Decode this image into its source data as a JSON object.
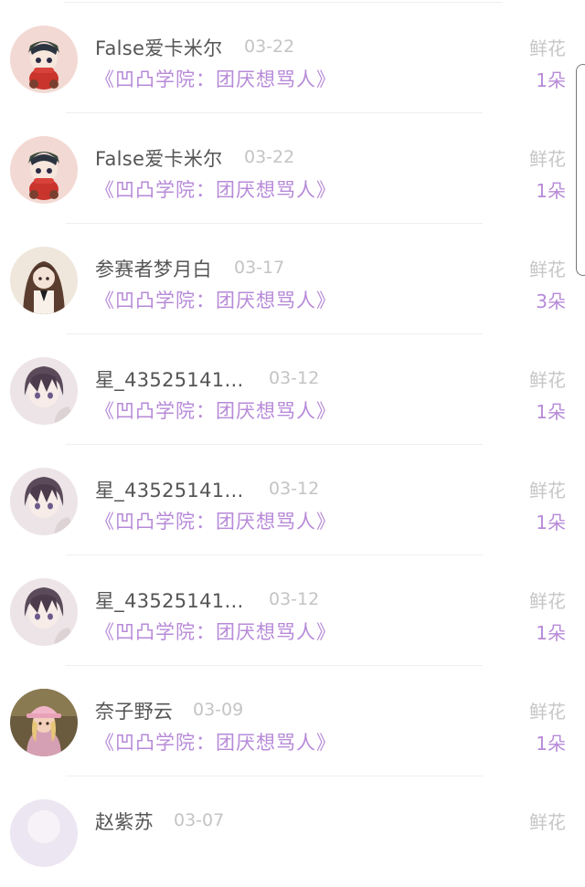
{
  "rows": [
    {
      "name": "False爱卡米尔",
      "date": "03-22",
      "title": "《凹凸学院：团厌想骂人》",
      "gift": "鲜花",
      "count": "1朵",
      "avatar": "chibi-red-scarf-avatar"
    },
    {
      "name": "False爱卡米尔",
      "date": "03-22",
      "title": "《凹凸学院：团厌想骂人》",
      "gift": "鲜花",
      "count": "1朵",
      "avatar": "chibi-red-scarf-avatar"
    },
    {
      "name": "参赛者梦月白",
      "date": "03-17",
      "title": "《凹凸学院：团厌想骂人》",
      "gift": "鲜花",
      "count": "3朵",
      "avatar": "long-hair-girl-avatar"
    },
    {
      "name": "星_43525141…",
      "date": "03-12",
      "title": "《凹凸学院：团厌想骂人》",
      "gift": "鲜花",
      "count": "1朵",
      "avatar": "dark-hair-boy-avatar"
    },
    {
      "name": "星_43525141…",
      "date": "03-12",
      "title": "《凹凸学院：团厌想骂人》",
      "gift": "鲜花",
      "count": "1朵",
      "avatar": "dark-hair-boy-avatar"
    },
    {
      "name": "星_43525141…",
      "date": "03-12",
      "title": "《凹凸学院：团厌想骂人》",
      "gift": "鲜花",
      "count": "1朵",
      "avatar": "dark-hair-boy-avatar"
    },
    {
      "name": "奈子野云",
      "date": "03-09",
      "title": "《凹凸学院：团厌想骂人》",
      "gift": "鲜花",
      "count": "1朵",
      "avatar": "pink-hat-girl-avatar"
    },
    {
      "name": "赵紫苏",
      "date": "03-07",
      "title": "",
      "gift": "鲜花",
      "count": "",
      "avatar": "light-avatar"
    }
  ],
  "colors": {
    "accent": "#b78ad8",
    "muted": "#c4c4c4",
    "name": "#555555",
    "divider": "#efefef"
  }
}
